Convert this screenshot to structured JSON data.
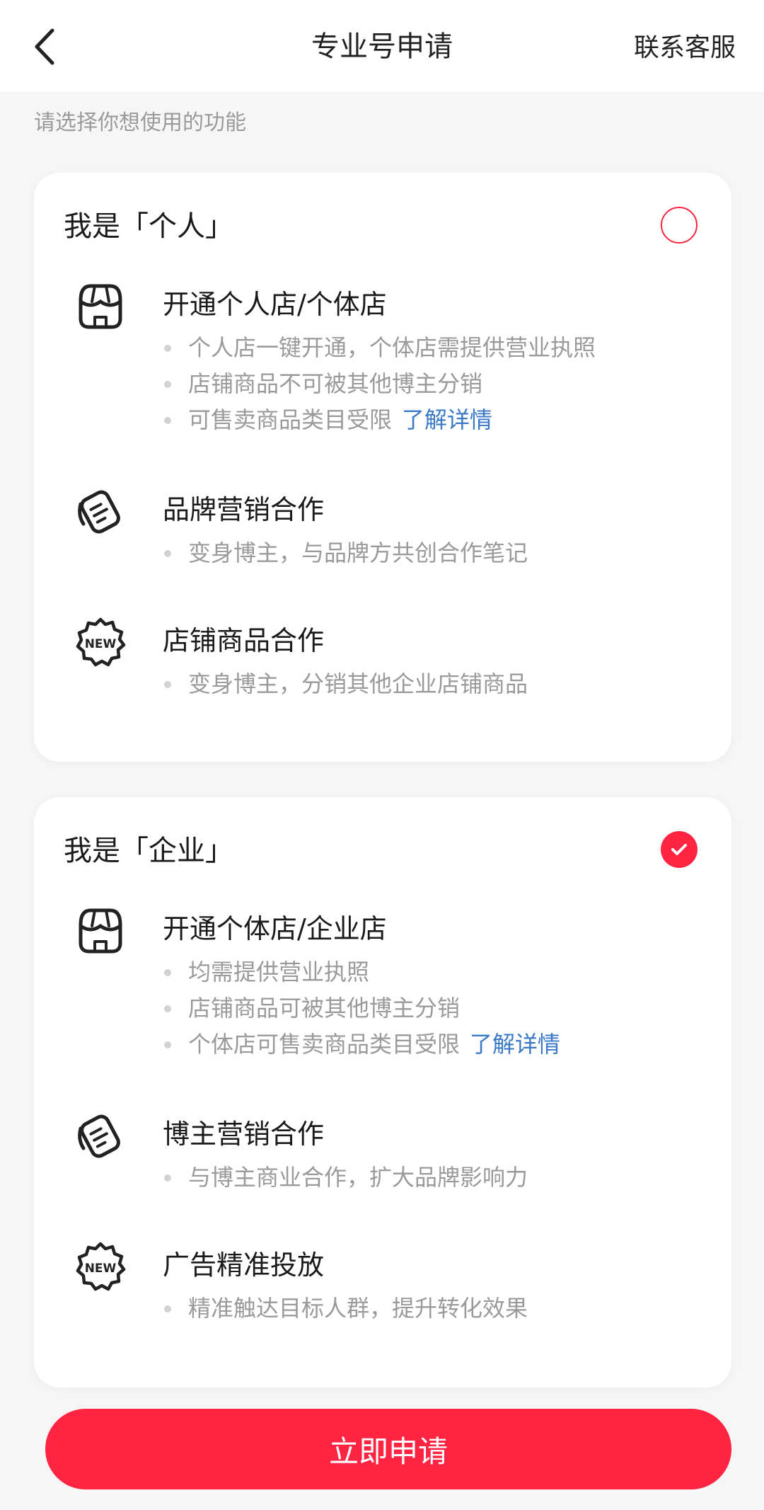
{
  "nav": {
    "title": "专业号申请",
    "action": "联系客服"
  },
  "subtitle": "请选择你想使用的功能",
  "colors": {
    "accent": "#ff2442",
    "link": "#3a78c8",
    "muted_text": "#9a9a9a"
  },
  "personal": {
    "title": "我是「个人」",
    "selected": false,
    "features": [
      {
        "icon": "storefront-icon",
        "title": "开通个人店/个体店",
        "bullets": [
          "个人店一键开通，个体店需提供营业执照",
          "店铺商品不可被其他博主分销",
          "可售卖商品类目受限"
        ],
        "link": "了解详情"
      },
      {
        "icon": "notes-cards-icon",
        "title": "品牌营销合作",
        "bullets": [
          "变身博主，与品牌方共创合作笔记"
        ]
      },
      {
        "icon": "new-badge-icon",
        "title": "店铺商品合作",
        "bullets": [
          "变身博主，分销其他企业店铺商品"
        ]
      }
    ]
  },
  "enterprise": {
    "title": "我是「企业」",
    "selected": true,
    "features": [
      {
        "icon": "storefront-icon",
        "title": "开通个体店/企业店",
        "bullets": [
          "均需提供营业执照",
          "店铺商品可被其他博主分销",
          "个体店可售卖商品类目受限"
        ],
        "link": "了解详情"
      },
      {
        "icon": "notes-cards-icon",
        "title": "博主营销合作",
        "bullets": [
          "与博主商业合作，扩大品牌影响力"
        ]
      },
      {
        "icon": "new-badge-icon",
        "title": "广告精准投放",
        "bullets": [
          "精准触达目标人群，提升转化效果"
        ]
      }
    ]
  },
  "apply_button": "立即申请"
}
